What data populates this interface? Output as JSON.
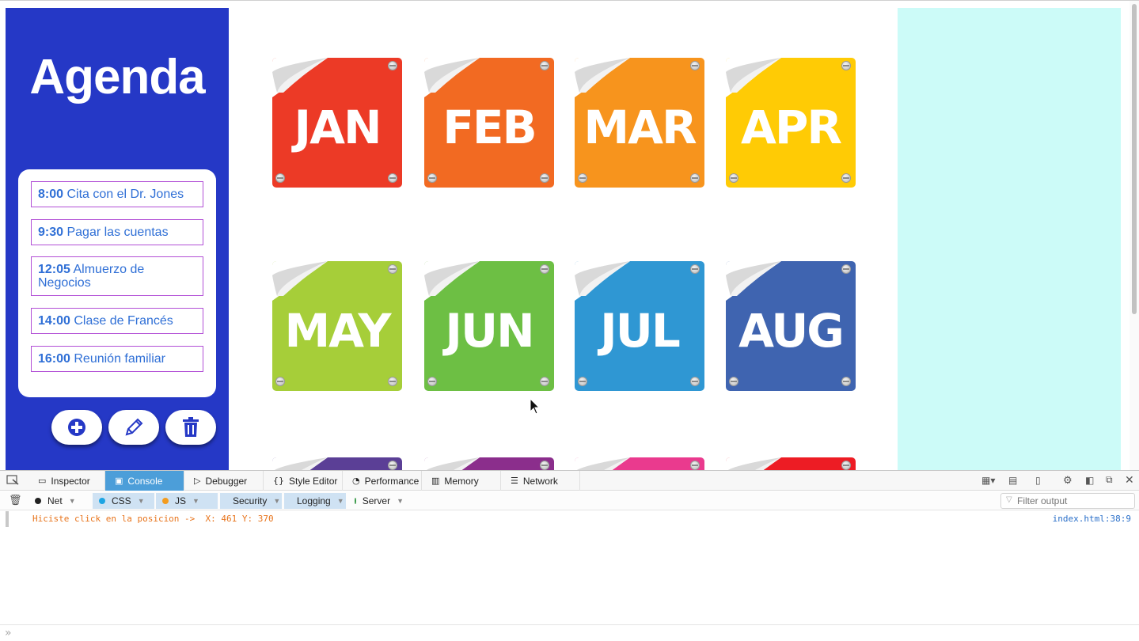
{
  "app": {
    "title": "Agenda",
    "agenda_items": [
      {
        "time": "8:00",
        "text": "Cita con el Dr. Jones"
      },
      {
        "time": "9:30",
        "text": "Pagar las cuentas"
      },
      {
        "time": "12:05",
        "text": "Almuerzo de Negocios"
      },
      {
        "time": "14:00",
        "text": "Clase de Francés"
      },
      {
        "time": "16:00",
        "text": "Reunión familiar"
      }
    ],
    "buttons": {
      "add": "plus-circle-icon",
      "edit": "pencil-icon",
      "delete": "trash-icon"
    }
  },
  "months": [
    {
      "label": "JAN",
      "color": "#ec3a26"
    },
    {
      "label": "FEB",
      "color": "#f26a22"
    },
    {
      "label": "MAR",
      "color": "#f7941d"
    },
    {
      "label": "APR",
      "color": "#ffcb05"
    },
    {
      "label": "MAY",
      "color": "#a6ce39"
    },
    {
      "label": "JUN",
      "color": "#6dbf44"
    },
    {
      "label": "JUL",
      "color": "#2f97d3"
    },
    {
      "label": "AUG",
      "color": "#3f64b0"
    },
    {
      "label": "",
      "color": "#5b3f96"
    },
    {
      "label": "",
      "color": "#8b2e8c"
    },
    {
      "label": "",
      "color": "#ea3a8e"
    },
    {
      "label": "",
      "color": "#ed1c24"
    }
  ],
  "devtools": {
    "tabs": [
      {
        "label": "Inspector",
        "icon": "inspector-icon",
        "active": false
      },
      {
        "label": "Console",
        "icon": "console-icon",
        "active": true
      },
      {
        "label": "Debugger",
        "icon": "debugger-icon",
        "active": false
      },
      {
        "label": "Style Editor",
        "icon": "braces-icon",
        "active": false
      },
      {
        "label": "Performance",
        "icon": "gauge-icon",
        "active": false
      },
      {
        "label": "Memory",
        "icon": "memory-icon",
        "active": false
      },
      {
        "label": "Network",
        "icon": "network-icon",
        "active": false
      }
    ],
    "filters": [
      {
        "label": "Net",
        "color": "#222222",
        "on": false
      },
      {
        "label": "CSS",
        "color": "#1ea5e3",
        "on": true
      },
      {
        "label": "JS",
        "color": "#f39c1f",
        "on": true
      },
      {
        "label": "Security",
        "color": "#e74c3c",
        "on": true
      },
      {
        "label": "Logging",
        "color": "#999999",
        "on": true
      },
      {
        "label": "Server",
        "color": "#3a9a4a",
        "on": false
      }
    ],
    "filter_placeholder": "Filter output",
    "console_message": "Hiciste click en la posicion ->  X: 461 Y: 370",
    "console_location": "index.html:38:9",
    "prompt_symbol": "»"
  }
}
